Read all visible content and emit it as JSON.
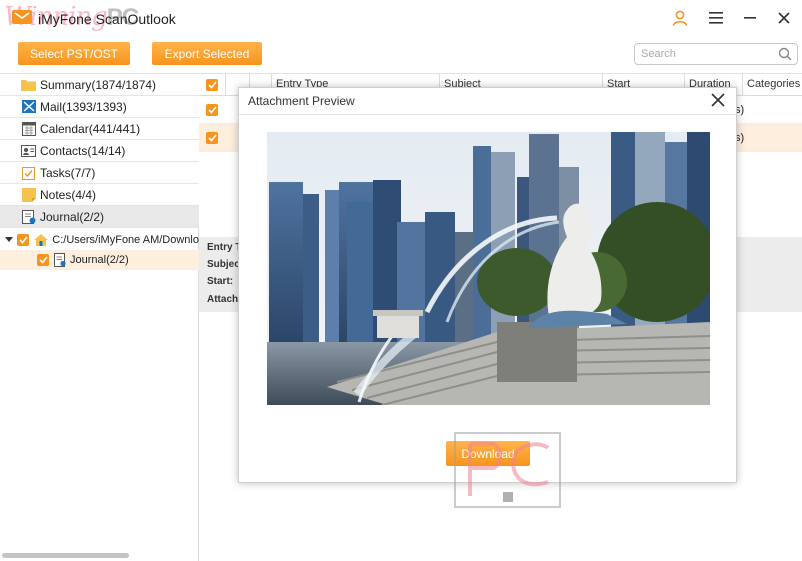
{
  "app": {
    "title": "iMyFone ScanOutlook"
  },
  "toolbar": {
    "select_label": "Select PST/OST",
    "export_label": "Export Selected",
    "search_placeholder": "Search"
  },
  "sidebar": {
    "items": [
      {
        "label": "Summary(1874/1874)",
        "icon": "folder-icon"
      },
      {
        "label": "Mail(1393/1393)",
        "icon": "mail-icon"
      },
      {
        "label": "Calendar(441/441)",
        "icon": "calendar-icon"
      },
      {
        "label": "Contacts(14/14)",
        "icon": "contacts-icon"
      },
      {
        "label": "Tasks(7/7)",
        "icon": "tasks-icon"
      },
      {
        "label": "Notes(4/4)",
        "icon": "notes-icon"
      },
      {
        "label": "Journal(2/2)",
        "icon": "journal-icon"
      }
    ],
    "tree": {
      "path": "C:/Users/iMyFone AM/Downlo",
      "child": "Journal(2/2)"
    }
  },
  "table": {
    "columns": [
      "Entry Type",
      "Subject",
      "Start",
      "Duration",
      "Categories"
    ],
    "row_suffix": "s)"
  },
  "detail": {
    "labels": [
      "Entry T",
      "Subjec",
      "Start:",
      "Attach"
    ]
  },
  "modal": {
    "title": "Attachment Preview",
    "download_label": "Download"
  },
  "colors": {
    "accent": "#f7941d",
    "selected_row": "#fdeedd"
  }
}
